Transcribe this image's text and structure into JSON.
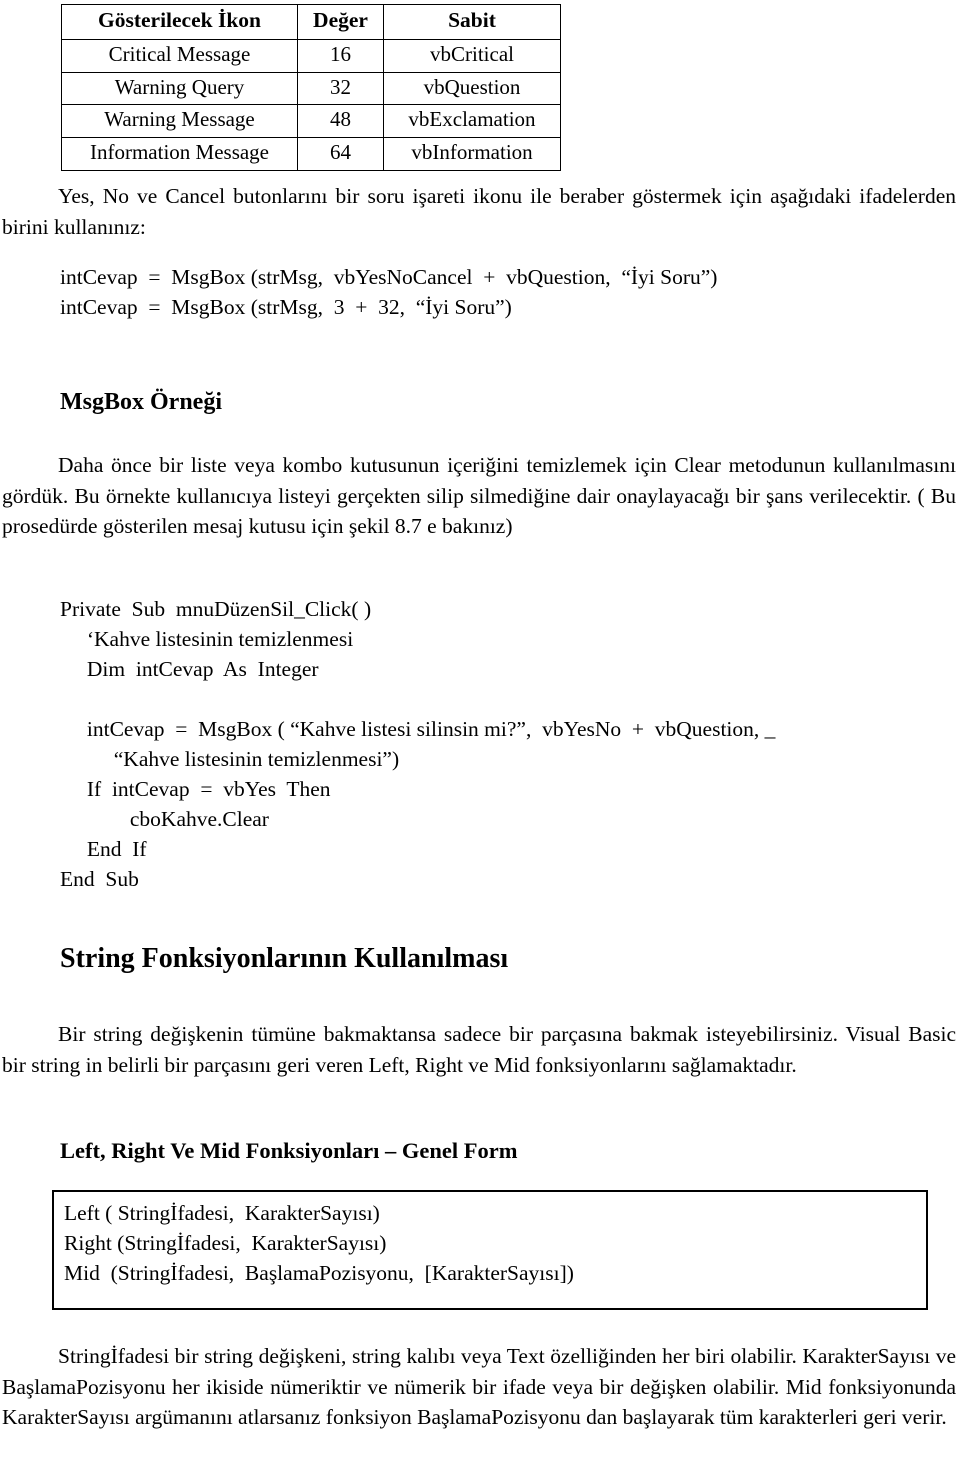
{
  "document": {
    "language": "tr",
    "table": {
      "headers": [
        "Gösterilecek İkon",
        "Değer",
        "Sabit"
      ],
      "rows": [
        [
          "Critical Message",
          "16",
          "vbCritical"
        ],
        [
          "Warning Query",
          "32",
          "vbQuestion"
        ],
        [
          "Warning Message",
          "48",
          "vbExclamation"
        ],
        [
          "Information Message",
          "64",
          "vbInformation"
        ]
      ]
    },
    "intro_paragraph": "Yes, No ve Cancel butonlarını bir soru işareti ikonu ile beraber göstermek için aşağıdaki ifadelerden birini kullanınız:",
    "intro_code": "intCevap  =  MsgBox (strMsg,  vbYesNoCancel  +  vbQuestion,  “İyi Soru”)\nintCevap  =  MsgBox (strMsg,  3  +  32,  “İyi Soru”)",
    "msgbox_example_heading": "MsgBox Örneği",
    "msgbox_example_paragraph": "Daha önce bir liste veya kombo kutusunun içeriğini temizlemek için Clear metodunun kullanılmasını gördük. Bu örnekte kullanıcıya listeyi gerçekten silip silmediğine dair onaylayacağı bir şans verilecektir. ( Bu prosedürde gösterilen mesaj kutusu için şekil 8.7 e bakınız)",
    "msgbox_example_code": "Private  Sub  mnuDüzenSil_Click( )\n     ‘Kahve listesinin temizlenmesi\n     Dim  intCevap  As  Integer\n\n     intCevap  =  MsgBox ( “Kahve listesi silinsin mi?”,  vbYesNo  +  vbQuestion, _\n          “Kahve listesinin temizlenmesi”)\n     If  intCevap  =  vbYes  Then\n             cboKahve.Clear\n     End  If\nEnd  Sub",
    "string_functions_heading": "String Fonksiyonlarının Kullanılması",
    "string_functions_paragraph": "Bir string değişkenin tümüne bakmaktansa sadece bir parçasına bakmak isteyebilirsiniz. Visual Basic bir string in belirli bir parçasını geri veren Left, Right ve Mid fonksiyonlarını sağlamaktadır.",
    "general_form_heading": "Left, Right Ve Mid Fonksiyonları – Genel Form",
    "general_form_syntax": "Left ( Stringİfadesi,  KarakterSayısı)\nRight (Stringİfadesi,  KarakterSayısı)\nMid  (Stringİfadesi,  BaşlamaPozisyonu,  [KarakterSayısı])",
    "closing_paragraph": "Stringİfadesi bir string değişkeni, string kalıbı veya Text özelliğinden her biri olabilir. KarakterSayısı ve BaşlamaPozisyonu her ikiside nümeriktir ve nümerik bir ifade veya bir değişken olabilir. Mid fonksiyonunda KarakterSayısı argümanını atlarsanız fonksiyon BaşlamaPozisyonu dan başlayarak tüm karakterleri geri verir."
  }
}
